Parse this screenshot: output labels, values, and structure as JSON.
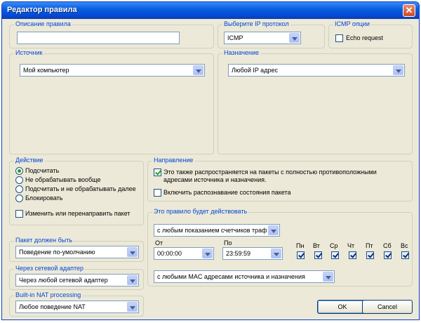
{
  "window": {
    "title": "Редактор правила",
    "close_glyph": "✕"
  },
  "rule_description": {
    "legend": "Описание правила",
    "value": ""
  },
  "protocol": {
    "legend": "Выберите IP протокол",
    "selected": "ICMP"
  },
  "icmp_options": {
    "legend": "ICMP опции",
    "echo_label": "Echo request",
    "echo_checked": false
  },
  "source": {
    "legend": "Источник",
    "selected": "Мой компьютер"
  },
  "destination": {
    "legend": "Назначение",
    "selected": "Любой IP адрес"
  },
  "action": {
    "legend": "Действие",
    "options": [
      "Подсчитать",
      "Не обрабатывать вообще",
      "Подсчитать и не обрабатывать далее",
      "Блокировать"
    ],
    "selected_index": 0,
    "redirect_label": "Изменить или перенаправить пакет"
  },
  "direction": {
    "legend": "Направление",
    "mirror_line1": "Это также распространяется на пакеты с полностью противоположными",
    "mirror_line2": "адресами источника и назначения.",
    "stateful_label": "Включить распознавание состояния пакета"
  },
  "schedule": {
    "legend": "Это правило будет действовать",
    "counter_selected": "с любым показанием счетчиков трафика",
    "from_label": "От",
    "to_label": "По",
    "from_value": "00:00:00",
    "to_value": "23:59:59",
    "days": [
      "Пн",
      "Вт",
      "Ср",
      "Чт",
      "Пт",
      "Сб",
      "Вс"
    ],
    "mac_selected": "с любыми MAC адресами источника и назначения"
  },
  "packet_must_be": {
    "legend": "Пакет должен быть",
    "selected": "Поведение по-умолчанию"
  },
  "via_adapter": {
    "legend": "Через сетевой адаптер",
    "selected": "Через любой сетевой адаптер"
  },
  "nat": {
    "legend": "Built-in NAT processing",
    "selected": "Любое поведение NAT"
  },
  "buttons": {
    "ok": "OK",
    "cancel": "Cancel"
  },
  "colors": {
    "title_bar": "#0a5fe0",
    "legend_text": "#0046d5",
    "dialog_bg": "#ece9d8"
  }
}
